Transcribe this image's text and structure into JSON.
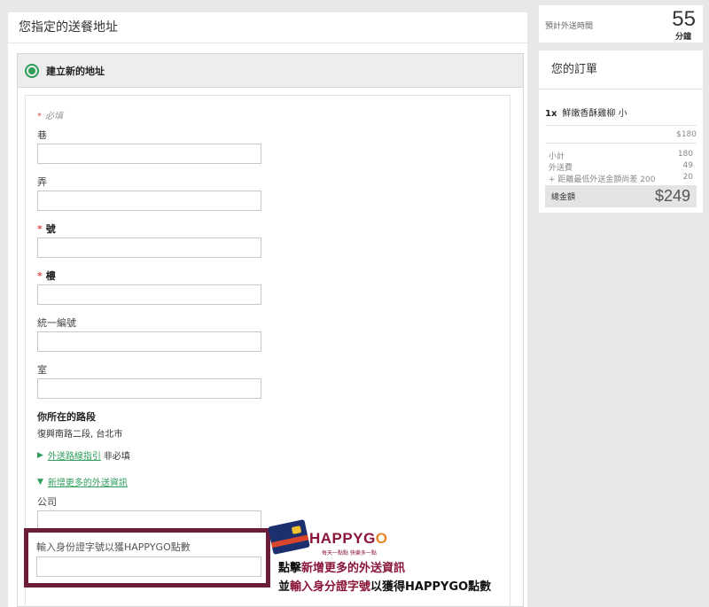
{
  "main": {
    "title": "您指定的送餐地址",
    "new_address_label": "建立新的地址",
    "required_note": "必填",
    "fields": {
      "lane": "巷",
      "alley": "弄",
      "number": "號",
      "floor": "樓",
      "tax_id": "統一編號",
      "room": "室",
      "company": "公司"
    },
    "road_heading": "你所在的路段",
    "road_value": "復興南路二段, 台北市",
    "directions_link": "外送路線指引",
    "directions_optional": "非必填",
    "more_info_link": "新增更多的外送資訊",
    "id_field_label": "輸入身份證字號以獲HAPPYGO點數"
  },
  "promo": {
    "logo_text": "HAPPYG",
    "logo_o": "O",
    "slogan": "每天一點點 快樂多一點",
    "line1_pre": "點擊",
    "line1_hl": "新增更多的外送資訊",
    "line2_pre": "並",
    "line2_hl": "輸入身分證字號",
    "line2_post": "以獲得HAPPYGO點數",
    "colors": {
      "highlight": "#8a1538",
      "box": "#6b1d3a",
      "accent": "#e7872a"
    }
  },
  "sidebar": {
    "time_label": "預計外送時間",
    "time_value": "55",
    "time_unit": "分鐘",
    "order_title": "您的訂單",
    "item_qty": "1x",
    "item_name": "鮮嫩香酥雞柳 小",
    "item_price": "$180",
    "subtotal_label": "小計",
    "subtotal_value": "180",
    "delivery_label": "外送費",
    "delivery_value": "49",
    "min_note_label": "+ 距離最低外送金額尚差 200",
    "min_note_value": "20",
    "total_label": "總金額",
    "total_value": "$249"
  },
  "colors": {
    "accent_green": "#2f9e5a",
    "required_red": "#d9534f"
  },
  "icons": {
    "radio": "radio-selected-icon",
    "triangle_right": "triangle-right-icon",
    "triangle_down": "triangle-down-icon"
  }
}
